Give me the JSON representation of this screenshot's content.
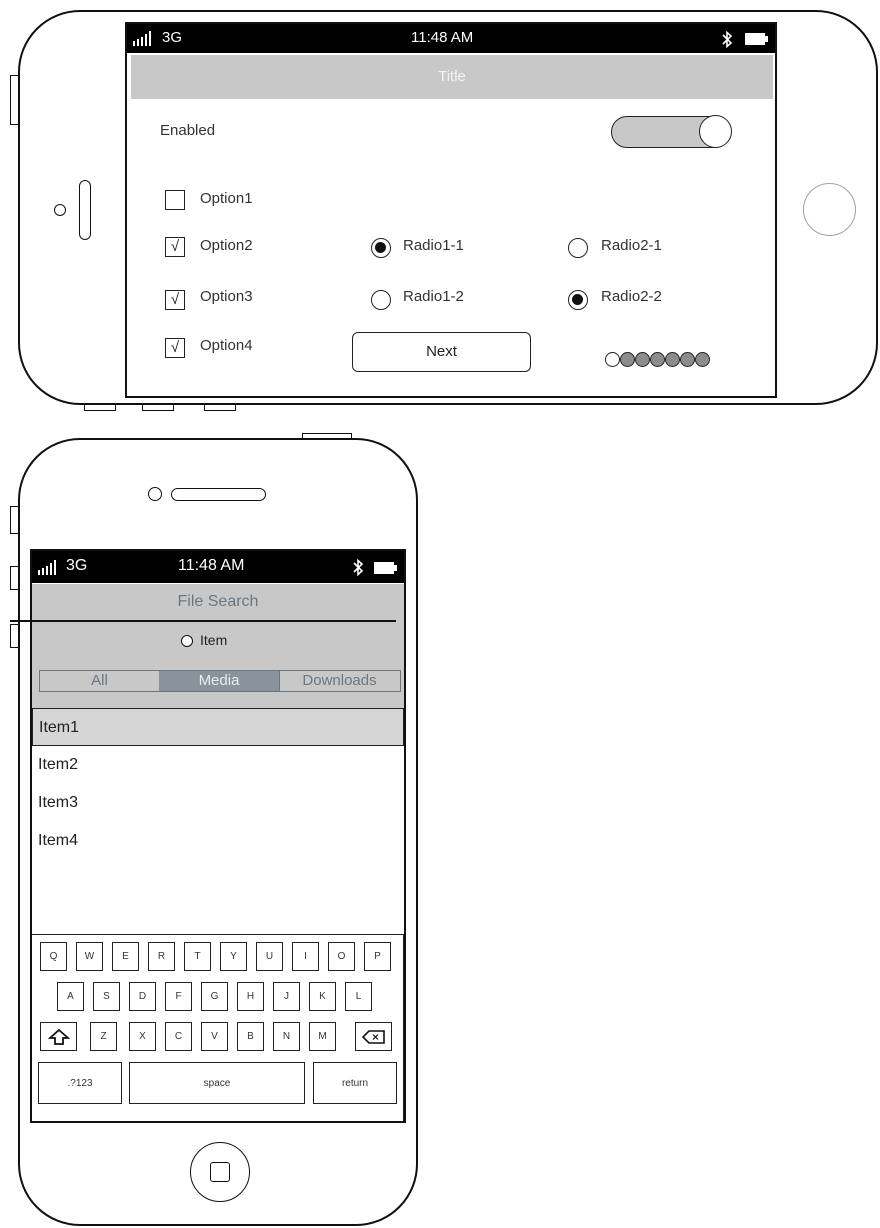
{
  "landscape": {
    "status": {
      "carrier": "3G",
      "time": "11:48 AM"
    },
    "title": "Title",
    "toggle": {
      "label": "Enabled",
      "on": true
    },
    "checkboxes": [
      {
        "label": "Option1",
        "checked": false,
        "mark": ""
      },
      {
        "label": "Option2",
        "checked": true,
        "mark": "√"
      },
      {
        "label": "Option3",
        "checked": true,
        "mark": "√"
      },
      {
        "label": "Option4",
        "checked": true,
        "mark": "√"
      }
    ],
    "radios_group1": [
      {
        "label": "Radio1-1",
        "selected": true
      },
      {
        "label": "Radio1-2",
        "selected": false
      }
    ],
    "radios_group2": [
      {
        "label": "Radio2-1",
        "selected": false
      },
      {
        "label": "Radio2-2",
        "selected": true
      }
    ],
    "next_button": "Next",
    "page_indicator": {
      "total": 7,
      "current": 1
    }
  },
  "portrait": {
    "status": {
      "carrier": "3G",
      "time": "11:48 AM"
    },
    "title": "File Search",
    "search_option": "Item",
    "tabs": [
      {
        "label": "All",
        "active": false
      },
      {
        "label": "Media",
        "active": true
      },
      {
        "label": "Downloads",
        "active": false
      }
    ],
    "items": [
      {
        "label": "Item1",
        "selected": true
      },
      {
        "label": "Item2",
        "selected": false
      },
      {
        "label": "Item3",
        "selected": false
      },
      {
        "label": "Item4",
        "selected": false
      }
    ],
    "keyboard": {
      "row1": [
        "Q",
        "W",
        "E",
        "R",
        "T",
        "Y",
        "U",
        "I",
        "O",
        "P"
      ],
      "row2": [
        "A",
        "S",
        "D",
        "F",
        "G",
        "H",
        "J",
        "K",
        "L"
      ],
      "row3": [
        "Z",
        "X",
        "C",
        "V",
        "B",
        "N",
        "M"
      ],
      "numbers_key": ".?123",
      "space_key": "space",
      "return_key": "return"
    }
  },
  "colors": {
    "titlebar": "#c8c8c8",
    "active_tab": "#8a939c",
    "selected_item": "#d6d6d6",
    "page_dot_filled": "#8c8c8c"
  }
}
